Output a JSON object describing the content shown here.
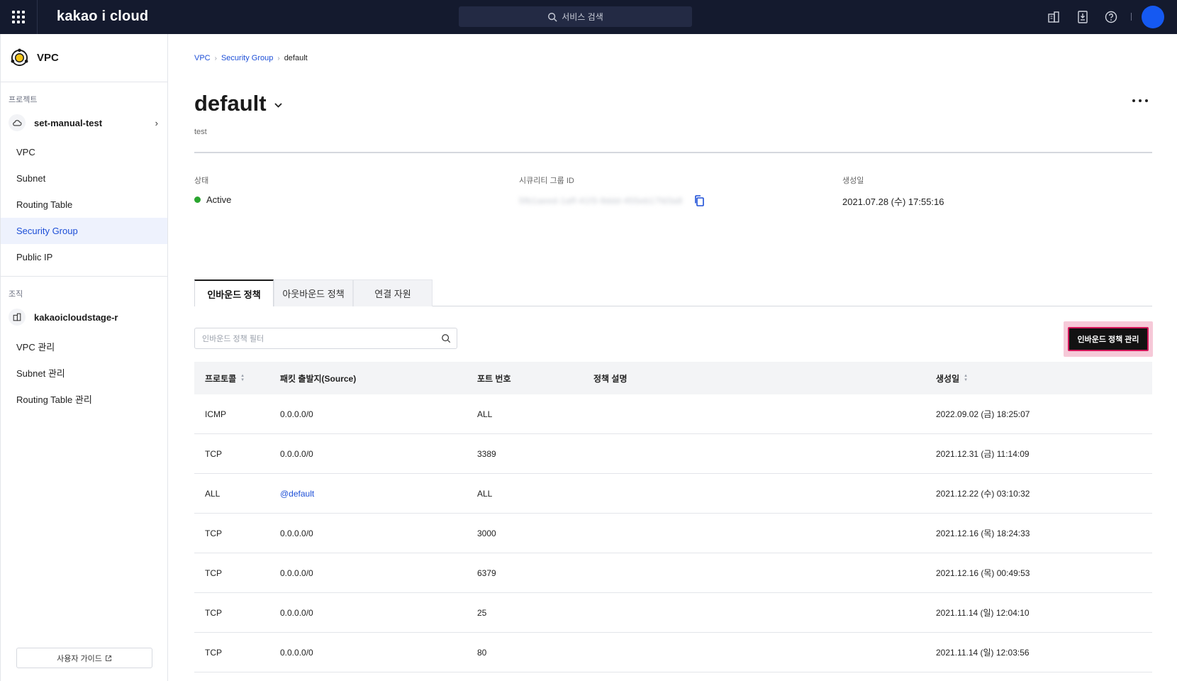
{
  "topbar": {
    "logo": "kakao i cloud",
    "search_placeholder": "서비스 검색"
  },
  "sidebar": {
    "service_title": "VPC",
    "project_label": "프로젝트",
    "project_name": "set-manual-test",
    "project_items": [
      {
        "label": "VPC"
      },
      {
        "label": "Subnet"
      },
      {
        "label": "Routing Table"
      },
      {
        "label": "Security Group",
        "active": true
      },
      {
        "label": "Public IP"
      }
    ],
    "org_label": "조직",
    "org_name": "kakaoicloudstage-r",
    "org_items": [
      {
        "label": "VPC 관리"
      },
      {
        "label": "Subnet 관리"
      },
      {
        "label": "Routing Table 관리"
      }
    ],
    "guide_button": "사용자 가이드"
  },
  "breadcrumb": [
    "VPC",
    "Security Group",
    "default"
  ],
  "page": {
    "title": "default",
    "subtitle": "test"
  },
  "info": {
    "status_label": "상태",
    "status_value": "Active",
    "id_label": "시큐리티 그룹 ID",
    "id_value": "5fb1aeed-1aff-41f3-9ddd-455eb17fd3a8",
    "created_label": "생성일",
    "created_value": "2021.07.28 (수) 17:55:16"
  },
  "tabs": [
    {
      "label": "인바운드 정책",
      "active": true
    },
    {
      "label": "아웃바운드 정책"
    },
    {
      "label": "연결 자원"
    }
  ],
  "filter_placeholder": "인바운드 정책 필터",
  "manage_button": "인바운드 정책 관리",
  "table": {
    "headers": [
      "프로토콜",
      "패킷 출발지(Source)",
      "포트 번호",
      "정책 설명",
      "생성일"
    ],
    "rows": [
      {
        "protocol": "ICMP",
        "source": "0.0.0.0/0",
        "port": "ALL",
        "desc": "",
        "created": "2022.09.02 (금) 18:25:07"
      },
      {
        "protocol": "TCP",
        "source": "0.0.0.0/0",
        "port": "3389",
        "desc": "",
        "created": "2021.12.31 (금) 11:14:09"
      },
      {
        "protocol": "ALL",
        "source": "@default",
        "port": "ALL",
        "desc": "",
        "created": "2021.12.22 (수) 03:10:32"
      },
      {
        "protocol": "TCP",
        "source": "0.0.0.0/0",
        "port": "3000",
        "desc": "",
        "created": "2021.12.16 (목) 18:24:33"
      },
      {
        "protocol": "TCP",
        "source": "0.0.0.0/0",
        "port": "6379",
        "desc": "",
        "created": "2021.12.16 (목) 00:49:53"
      },
      {
        "protocol": "TCP",
        "source": "0.0.0.0/0",
        "port": "25",
        "desc": "",
        "created": "2021.11.14 (일) 12:04:10"
      },
      {
        "protocol": "TCP",
        "source": "0.0.0.0/0",
        "port": "80",
        "desc": "",
        "created": "2021.11.14 (일) 12:03:56"
      }
    ]
  }
}
